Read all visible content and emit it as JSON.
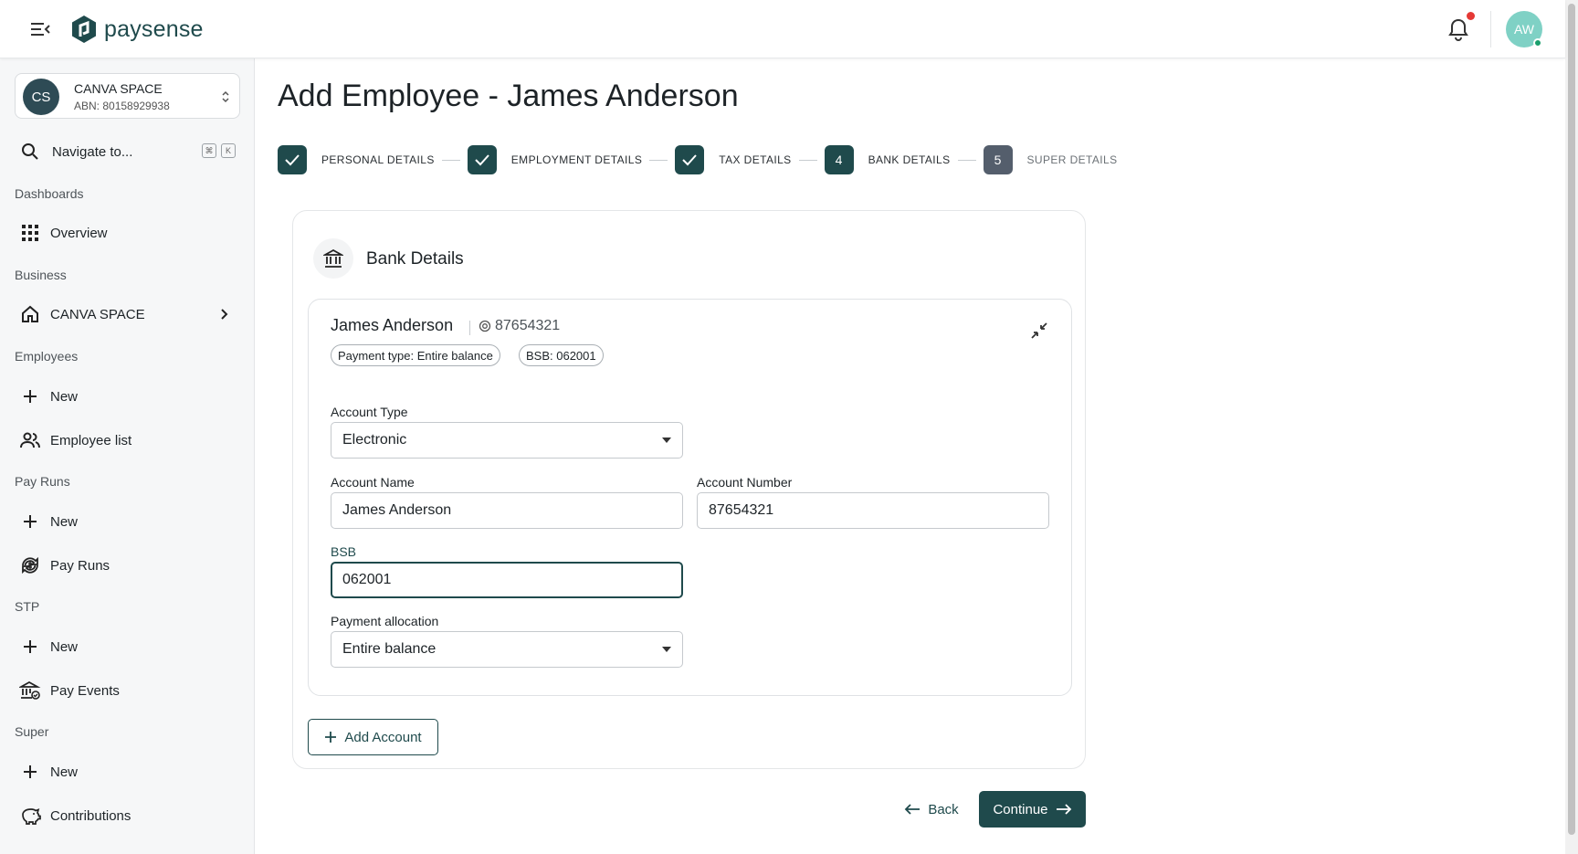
{
  "header": {
    "logo_text": "paysense",
    "avatar_initials": "AW"
  },
  "sidebar": {
    "org": {
      "initials": "CS",
      "name": "CANVA SPACE",
      "abn": "ABN: 80158929938"
    },
    "search_label": "Navigate to...",
    "kbd": [
      "⌘",
      "K"
    ],
    "sections": [
      {
        "title": "Dashboards",
        "items": [
          {
            "label": "Overview",
            "icon": "grid-icon"
          }
        ]
      },
      {
        "title": "Business",
        "items": [
          {
            "label": "CANVA SPACE",
            "icon": "home-icon"
          }
        ]
      },
      {
        "title": "Employees",
        "items": [
          {
            "label": "New",
            "icon": "plus-icon"
          },
          {
            "label": "Employee list",
            "icon": "people-icon"
          }
        ]
      },
      {
        "title": "Pay Runs",
        "items": [
          {
            "label": "New",
            "icon": "plus-icon"
          },
          {
            "label": "Pay Runs",
            "icon": "sync-dollar-icon"
          }
        ]
      },
      {
        "title": "STP",
        "items": [
          {
            "label": "New",
            "icon": "plus-icon"
          },
          {
            "label": "Pay Events",
            "icon": "bank-check-icon"
          }
        ]
      },
      {
        "title": "Super",
        "items": [
          {
            "label": "New",
            "icon": "plus-icon"
          },
          {
            "label": "Contributions",
            "icon": "piggy-bank-icon"
          }
        ]
      }
    ]
  },
  "main": {
    "title": "Add Employee - James Anderson",
    "steps": [
      {
        "label": "PERSONAL DETAILS",
        "state": "done"
      },
      {
        "label": "EMPLOYMENT DETAILS",
        "state": "done"
      },
      {
        "label": "TAX DETAILS",
        "state": "done"
      },
      {
        "label": "BANK DETAILS",
        "state": "current",
        "number": "4"
      },
      {
        "label": "SUPER DETAILS",
        "state": "future",
        "number": "5"
      }
    ],
    "card": {
      "title": "Bank Details",
      "account": {
        "name": "James Anderson",
        "number": "87654321",
        "chips": [
          "Payment type: Entire balance",
          "BSB: 062001"
        ],
        "fields": {
          "account_type": {
            "label": "Account Type",
            "value": "Electronic"
          },
          "account_name": {
            "label": "Account Name",
            "value": "James Anderson"
          },
          "account_number": {
            "label": "Account Number",
            "value": "87654321"
          },
          "bsb": {
            "label": "BSB",
            "value": "062001"
          },
          "payment_allocation": {
            "label": "Payment allocation",
            "value": "Entire balance"
          }
        }
      },
      "add_account_label": "Add Account"
    },
    "back_label": "Back",
    "continue_label": "Continue"
  },
  "colors": {
    "brand": "#1f4a4c",
    "future_step": "#545e6c",
    "notification": "#e53935",
    "avatar": "#7fd1c5"
  }
}
